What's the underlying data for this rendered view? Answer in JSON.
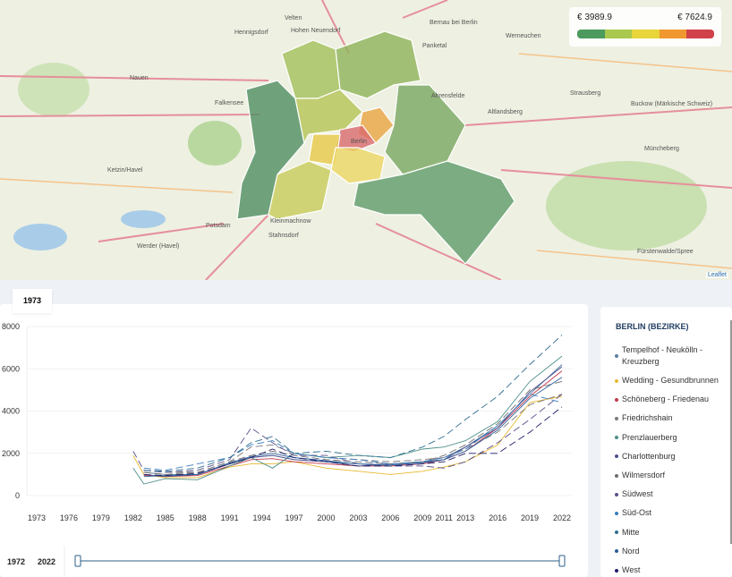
{
  "map": {
    "scale": {
      "min_label": "€ 3989.9",
      "max_label": "€ 7624.9",
      "colors": [
        "#4c9a5e",
        "#a9c84d",
        "#e7d53a",
        "#f0982f",
        "#d0414a"
      ]
    },
    "attribution": "Leaflet",
    "places": [
      "Velten",
      "Hohen Neuendorf",
      "Bernau bei Berlin",
      "Hennigsdorf",
      "Panketal",
      "Werneuchen",
      "Nauen",
      "Falkensee",
      "Ahrensfelde",
      "Altlandsberg",
      "Strausberg",
      "Buckow (Märkische Schweiz)",
      "Berlin",
      "Ketzin/Havel",
      "Müncheberg",
      "Potsdam",
      "Kleinmachnow",
      "Stahnsdorf",
      "Werder (Havel)",
      "Fürstenwalde/Spree"
    ],
    "district_colors": [
      "#4f8f62",
      "#a3c15a",
      "#8fb45a",
      "#b5c455",
      "#e9a544",
      "#d96a6e",
      "#e7c94a",
      "#ecd764",
      "#79a863",
      "#c7cc5a",
      "#5f9b6a"
    ]
  },
  "chart": {
    "selected_year": "1973",
    "range_start": "1972",
    "range_end": "2022"
  },
  "chart_data": {
    "type": "line",
    "ylim": [
      0,
      8000
    ],
    "yticks": [
      "0",
      "2000",
      "4000",
      "6000",
      "8000"
    ],
    "xticks": [
      "1973",
      "1976",
      "1979",
      "1982",
      "1985",
      "1988",
      "1991",
      "1994",
      "1997",
      "2000",
      "2003",
      "2006",
      "2009",
      "2011",
      "2013",
      "2016",
      "2019",
      "2022"
    ],
    "x": [
      1982,
      1983,
      1985,
      1988,
      1991,
      1993,
      1995,
      1997,
      2000,
      2003,
      2006,
      2009,
      2011,
      2013,
      2016,
      2019,
      2022
    ],
    "legend_title": "BERLIN (BEZIRKE)",
    "series": [
      {
        "name": "Tempelhof - Neukölln - Kreuzberg",
        "color": "#5b7fa0",
        "dashed": false,
        "values": [
          null,
          1100,
          1000,
          1000,
          1500,
          1800,
          1900,
          1700,
          1600,
          1500,
          1400,
          1600,
          1800,
          2300,
          3300,
          4800,
          6200
        ]
      },
      {
        "name": "Wedding - Gesundbrunnen",
        "color": "#e8b830",
        "dashed": false,
        "values": [
          1900,
          1000,
          850,
          850,
          1350,
          1500,
          1500,
          1600,
          1300,
          1150,
          1000,
          1150,
          1350,
          1600,
          2400,
          4400,
          4700
        ]
      },
      {
        "name": "Schöneberg - Friedenau",
        "color": "#c0394b",
        "dashed": false,
        "values": [
          null,
          950,
          900,
          950,
          1400,
          1700,
          1750,
          1600,
          1500,
          1400,
          1400,
          1500,
          1700,
          2100,
          3200,
          4700,
          5900
        ]
      },
      {
        "name": "Friedrichshain",
        "color": "#7a7a7a",
        "dashed": true,
        "values": [
          null,
          1200,
          1100,
          1100,
          1600,
          2300,
          2400,
          2000,
          1800,
          1700,
          1600,
          1700,
          1800,
          2200,
          3000,
          4300,
          4800
        ]
      },
      {
        "name": "Prenzlauerberg",
        "color": "#4d8f8a",
        "dashed": false,
        "values": [
          1300,
          550,
          800,
          750,
          1400,
          1800,
          1300,
          2000,
          1800,
          1900,
          1800,
          2200,
          2300,
          2600,
          3500,
          5400,
          6600
        ]
      },
      {
        "name": "Charlottenburg",
        "color": "#4a4f8f",
        "dashed": false,
        "values": [
          null,
          1000,
          900,
          1000,
          1500,
          1800,
          1900,
          1700,
          1600,
          1400,
          1500,
          1600,
          1700,
          2300,
          3200,
          4900,
          6100
        ]
      },
      {
        "name": "Wilmersdorf",
        "color": "#6e6e6e",
        "dashed": true,
        "values": [
          null,
          1100,
          1000,
          1100,
          1600,
          1900,
          2100,
          1900,
          1700,
          1600,
          1500,
          1600,
          1900,
          2400,
          3400,
          5000,
          5400
        ]
      },
      {
        "name": "Südwest",
        "color": "#5a4f8a",
        "dashed": true,
        "values": [
          2100,
          1200,
          1100,
          1200,
          1700,
          3200,
          2500,
          1900,
          1900,
          1500,
          1400,
          1400,
          1300,
          1600,
          2500,
          3600,
          4800
        ]
      },
      {
        "name": "Süd-Ost",
        "color": "#3a7dc0",
        "dashed": true,
        "values": [
          null,
          1300,
          1200,
          1500,
          1800,
          2400,
          2600,
          2000,
          1800,
          1700,
          1500,
          1600,
          1800,
          2200,
          3300,
          4800,
          4400
        ]
      },
      {
        "name": "Mitte",
        "color": "#2f6f8f",
        "dashed": true,
        "values": [
          null,
          1200,
          1150,
          1300,
          1800,
          2500,
          2800,
          2000,
          2100,
          1900,
          1800,
          2300,
          2800,
          3600,
          4700,
          6200,
          7600
        ]
      },
      {
        "name": "Nord",
        "color": "#2a5f9a",
        "dashed": false,
        "values": [
          null,
          900,
          950,
          1000,
          1550,
          1850,
          2000,
          1800,
          1650,
          1500,
          1450,
          1550,
          1700,
          2100,
          3100,
          4600,
          5600
        ]
      },
      {
        "name": "West",
        "color": "#1f1f6a",
        "dashed": true,
        "values": [
          null,
          1000,
          950,
          1050,
          1500,
          1800,
          2200,
          1800,
          1600,
          1400,
          1400,
          1500,
          1600,
          2000,
          2000,
          3000,
          4200
        ]
      }
    ]
  }
}
